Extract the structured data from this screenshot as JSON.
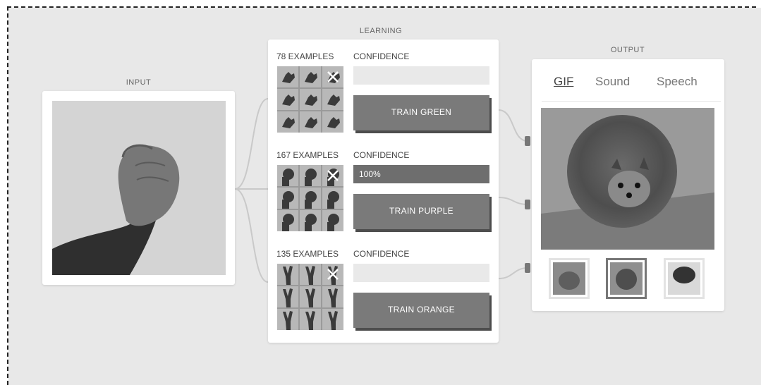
{
  "sections": {
    "input": "INPUT",
    "learning": "LEARNING",
    "output": "OUTPUT"
  },
  "learning": {
    "classes": [
      {
        "examples": "78 EXAMPLES",
        "confidence_label": "CONFIDENCE",
        "confidence_value": "",
        "confidence_fraction": 0,
        "button": "TRAIN GREEN",
        "gesture": "hand"
      },
      {
        "examples": "167 EXAMPLES",
        "confidence_label": "CONFIDENCE",
        "confidence_value": "100%",
        "confidence_fraction": 1,
        "button": "TRAIN PURPLE",
        "gesture": "fist"
      },
      {
        "examples": "135 EXAMPLES",
        "confidence_label": "CONFIDENCE",
        "confidence_value": "",
        "confidence_fraction": 0,
        "button": "TRAIN ORANGE",
        "gesture": "peace"
      }
    ]
  },
  "output": {
    "tabs": [
      "GIF",
      "Sound",
      "Speech"
    ],
    "active_tab": "GIF",
    "selected_gif": 1,
    "gifs": [
      "dog-grass",
      "pomeranian-running",
      "dog-snow"
    ]
  },
  "colors": {
    "canvas": "#e8e8e8",
    "button": "#7a7a7a",
    "fill": "#6e6e6e"
  }
}
